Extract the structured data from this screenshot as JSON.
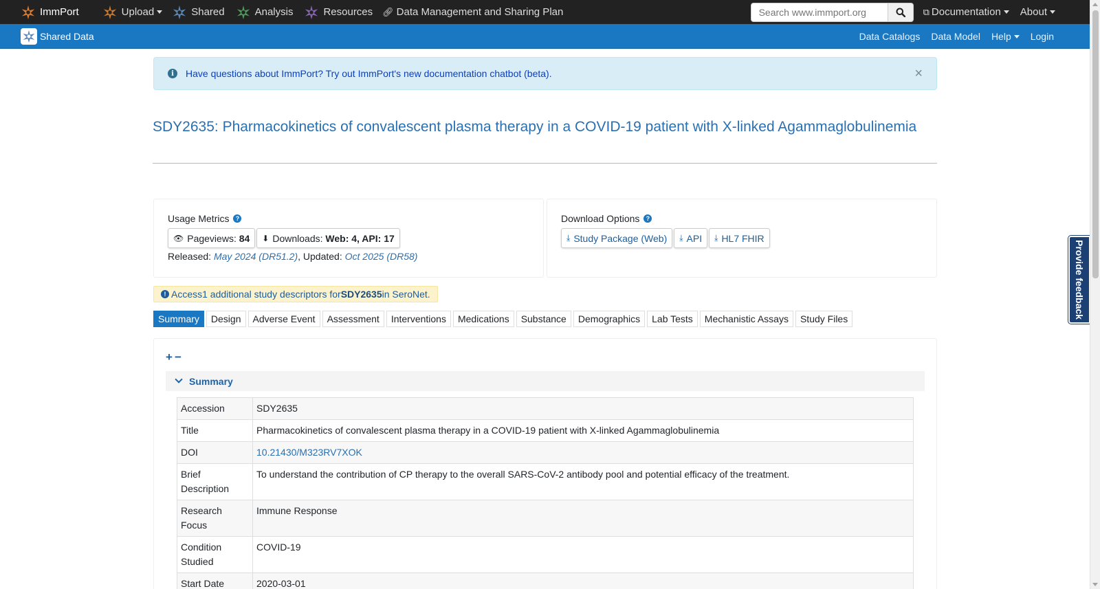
{
  "topnav": {
    "brand": "ImmPort",
    "items": [
      {
        "label": "Upload",
        "dropdown": true,
        "icon": "star-orange"
      },
      {
        "label": "Shared",
        "dropdown": false,
        "icon": "star-blue"
      },
      {
        "label": "Analysis",
        "dropdown": false,
        "icon": "star-green"
      },
      {
        "label": "Resources",
        "dropdown": false,
        "icon": "star-purple"
      },
      {
        "label": "Data Management and Sharing Plan",
        "dropdown": false,
        "icon": "link-icon"
      }
    ],
    "search_placeholder": "Search www.immport.org",
    "documentation": "Documentation",
    "about": "About"
  },
  "subnav": {
    "brand": "Shared Data",
    "items": [
      "Data Catalogs",
      "Data Model",
      "Help",
      "Login"
    ]
  },
  "alert": {
    "text": "Have questions about ImmPort? Try out ImmPort's new documentation chatbot (beta).",
    "close": "×"
  },
  "study": {
    "title": "SDY2635: Pharmacokinetics of convalescent plasma therapy in a COVID-19 patient with X-linked Agammaglobulinemia"
  },
  "usage": {
    "label": "Usage Metrics",
    "pageviews_label": "Pageviews:",
    "pageviews_value": "84",
    "downloads_label": "Downloads:",
    "downloads_value": "Web: 4, API: 17",
    "released_label": "Released:",
    "released_value": "May 2024 (DR51.2)",
    "updated_label": ", Updated:",
    "updated_value": "Oct 2025 (DR58)"
  },
  "download": {
    "label": "Download Options",
    "buttons": [
      "Study Package (Web)",
      "API",
      "HL7 FHIR"
    ]
  },
  "notice": {
    "prefix": "Access1 additional study descriptors for ",
    "study": "SDY2635",
    "suffix": " in SeroNet."
  },
  "tabs": [
    "Summary",
    "Design",
    "Adverse Event",
    "Assessment",
    "Interventions",
    "Medications",
    "Substance",
    "Demographics",
    "Lab Tests",
    "Mechanistic Assays",
    "Study Files"
  ],
  "summary": {
    "expand": "+",
    "collapse": "−",
    "heading": "Summary",
    "rows": [
      {
        "key": "Accession",
        "value": "SDY2635"
      },
      {
        "key": "Title",
        "value": "Pharmacokinetics of convalescent plasma therapy in a COVID-19 patient with X-linked Agammaglobulinemia"
      },
      {
        "key": "DOI",
        "value": "10.21430/M323RV7XOK"
      },
      {
        "key": "Brief Description",
        "value": "To understand the contribution of CP therapy to the overall SARS-CoV-2 antibody pool and potential efficacy of the treatment."
      },
      {
        "key": "Research Focus",
        "value": "Immune Response"
      },
      {
        "key": "Condition Studied",
        "value": "COVID-19"
      },
      {
        "key": "Start Date",
        "value": "2020-03-01"
      }
    ]
  },
  "feedback": "Provide feedback",
  "colors": {
    "navbar": "#222222",
    "subbar": "#1a77c2",
    "accent": "#2a6fb0"
  }
}
